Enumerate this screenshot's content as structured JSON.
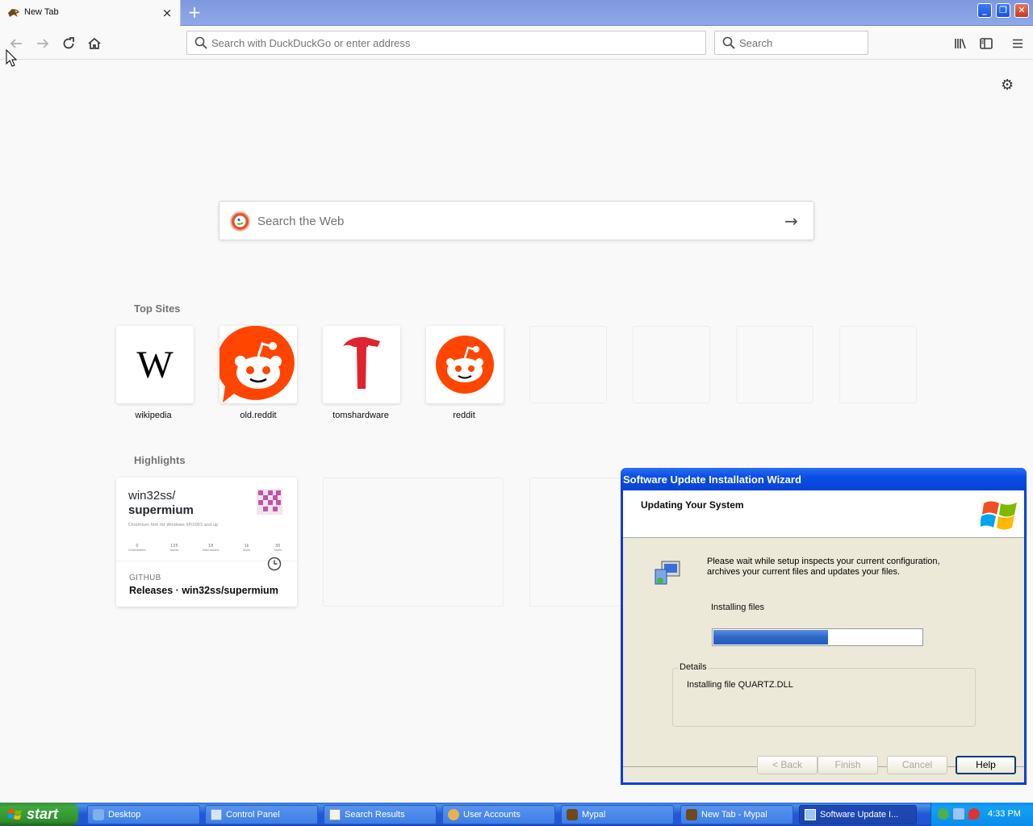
{
  "browser": {
    "tab": {
      "title": "New Tab",
      "close": "×"
    },
    "new_tab": "+",
    "url_placeholder": "Search with DuckDuckGo or enter address",
    "search_placeholder": "Search"
  },
  "newtab": {
    "web_search_placeholder": "Search the Web",
    "top_sites_title": "Top Sites",
    "top_sites": [
      {
        "label": "wikipedia"
      },
      {
        "label": "old.reddit"
      },
      {
        "label": "tomshardware"
      },
      {
        "label": "reddit"
      }
    ],
    "highlights_title": "Highlights",
    "highlight": {
      "repo_owner": "win32ss/",
      "repo_name": "supermium",
      "repo_desc": "Chromium fork for Windows XP/2003 and up",
      "stats": [
        {
          "value": "0",
          "label": "Contributors"
        },
        {
          "value": "135",
          "label": "Issues"
        },
        {
          "value": "18",
          "label": "Discussions"
        },
        {
          "value": "1k",
          "label": "Stars"
        },
        {
          "value": "35",
          "label": "Forks"
        }
      ],
      "source": "GITHUB",
      "title": "Releases · win32ss/supermium"
    }
  },
  "dialog": {
    "title": "Software Update Installation Wizard",
    "heading": "Updating Your System",
    "message": "Please wait while setup inspects your current configuration, archives your current files and updates your files.",
    "status": "Installing files",
    "progress": 0.55,
    "details_label": "Details",
    "details_text": "Installing file QUARTZ.DLL",
    "buttons": {
      "back": "< Back",
      "finish": "Finish",
      "cancel": "Cancel",
      "help": "Help"
    }
  },
  "taskbar": {
    "start": "start",
    "items": [
      {
        "label": "Desktop"
      },
      {
        "label": "Control Panel"
      },
      {
        "label": "Search Results"
      },
      {
        "label": "User Accounts"
      },
      {
        "label": "Mypal"
      },
      {
        "label": "New Tab - Mypal"
      },
      {
        "label": "Software Update I..."
      }
    ],
    "clock": "4:33 PM"
  },
  "colors": {
    "accent": "#0b3fd2",
    "progress": "#2f67c9",
    "reddit": "#ff4500",
    "tomshardware": "#e0232e"
  }
}
